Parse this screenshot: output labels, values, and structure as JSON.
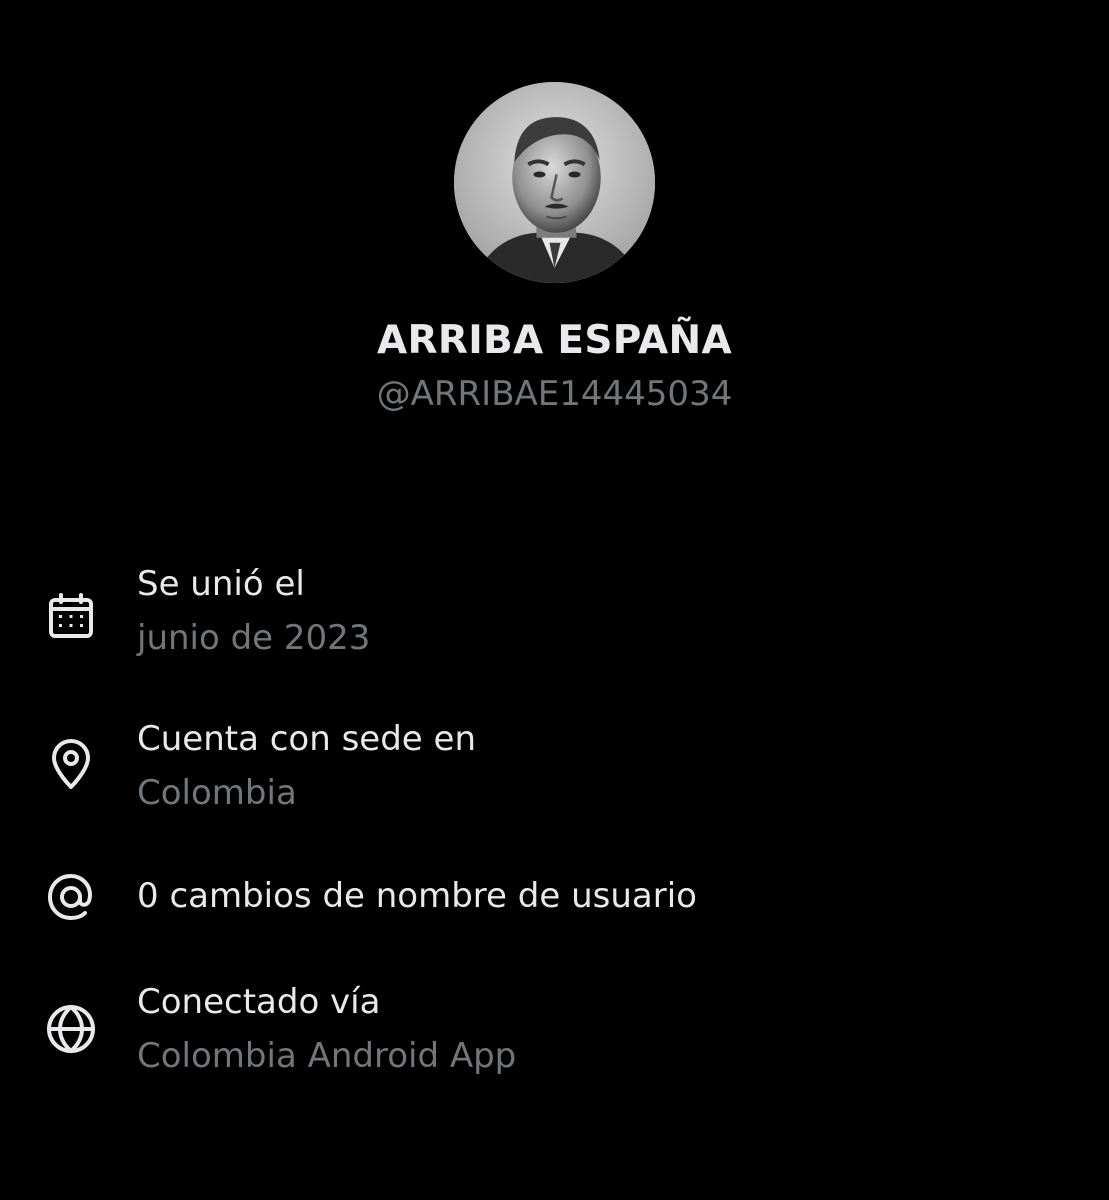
{
  "profile": {
    "display_name": "ARRIBA ESPAÑA",
    "handle": "@ARRIBAE14445034",
    "avatar": "profile-photo"
  },
  "about": {
    "joined": {
      "icon": "calendar-icon",
      "label": "Se unió el",
      "value": "junio de 2023"
    },
    "location": {
      "icon": "location-pin-icon",
      "label": "Cuenta con sede en",
      "value": "Colombia"
    },
    "username_changes": {
      "icon": "at-sign-icon",
      "label": "0 cambios de nombre de usuario"
    },
    "connected_via": {
      "icon": "globe-icon",
      "label": "Conectado vía",
      "value": "Colombia Android App"
    }
  },
  "colors": {
    "background": "#000000",
    "primary_text": "#e7e9ea",
    "secondary_text": "#71767b"
  }
}
